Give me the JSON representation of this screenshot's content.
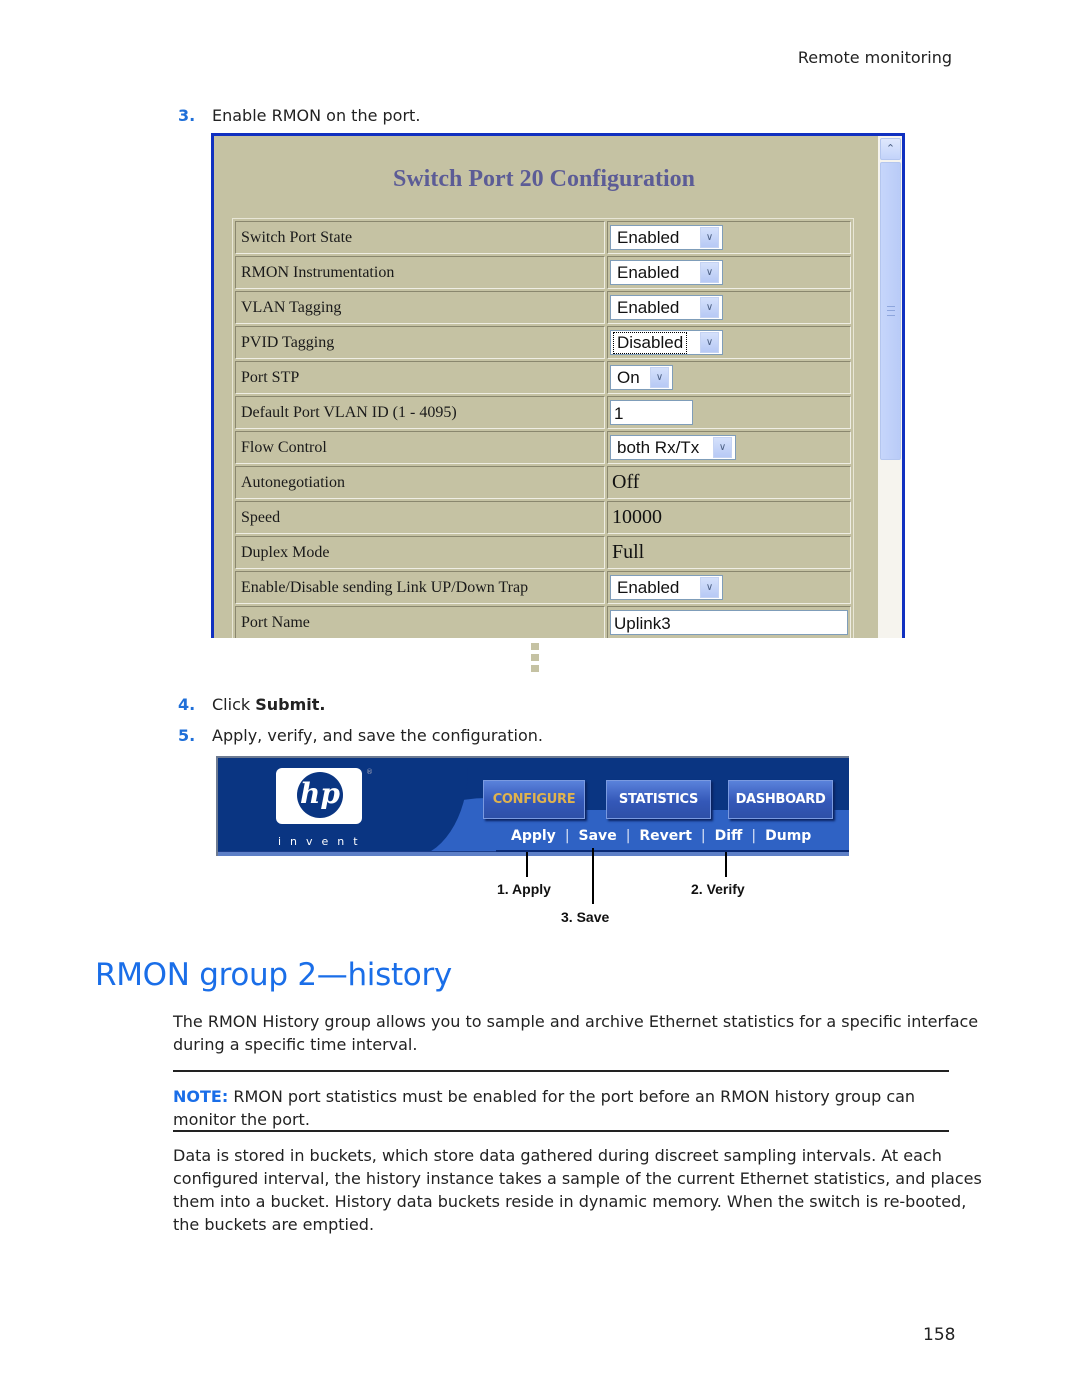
{
  "header": {
    "section": "Remote monitoring"
  },
  "steps": {
    "s3": {
      "num": "3.",
      "text": "Enable RMON on the port."
    },
    "s4": {
      "num": "4.",
      "prefix": "Click ",
      "bold": "Submit."
    },
    "s5": {
      "num": "5.",
      "text": "Apply, verify, and save the configuration."
    }
  },
  "switch_config": {
    "title": "Switch Port 20 Configuration",
    "rows": [
      {
        "label": "Switch Port State",
        "type": "select",
        "value": "Enabled"
      },
      {
        "label": "RMON Instrumentation",
        "type": "select",
        "value": "Enabled"
      },
      {
        "label": "VLAN Tagging",
        "type": "select",
        "value": "Enabled"
      },
      {
        "label": "PVID Tagging",
        "type": "select",
        "value": "Disabled"
      },
      {
        "label": "Port STP",
        "type": "select",
        "value": "On"
      },
      {
        "label": "Default Port VLAN ID (1 - 4095)",
        "type": "input",
        "value": "1"
      },
      {
        "label": "Flow Control",
        "type": "select",
        "value": "both Rx/Tx"
      },
      {
        "label": "Autonegotiation",
        "type": "text",
        "value": "Off"
      },
      {
        "label": "Speed",
        "type": "text",
        "value": "10000"
      },
      {
        "label": "Duplex Mode",
        "type": "text",
        "value": "Full"
      },
      {
        "label": "Enable/Disable sending Link UP/Down Trap",
        "type": "select",
        "value": "Enabled"
      },
      {
        "label": "Port Name",
        "type": "input",
        "value": "Uplink3"
      }
    ]
  },
  "hp_banner": {
    "logo_text": "hp",
    "tagline": "invent",
    "registered": "®",
    "tabs": [
      {
        "label": "CONFIGURE",
        "active": true
      },
      {
        "label": "STATISTICS",
        "active": false
      },
      {
        "label": "DASHBOARD",
        "active": false
      }
    ],
    "links": [
      "Apply",
      "Save",
      "Revert",
      "Diff",
      "Dump"
    ],
    "separator": "|",
    "callouts": {
      "apply": "1. Apply",
      "verify": "2. Verify",
      "save": "3. Save"
    }
  },
  "section": {
    "heading": "RMON group 2—history",
    "intro": "The RMON History group allows you to sample and archive Ethernet statistics for a specific interface during a specific time interval.",
    "note_label": "NOTE:",
    "note_text": " RMON port statistics must be enabled for the port before an RMON history group can monitor the port.",
    "body": "Data is stored in buckets, which store data gathered during discreet sampling intervals. At each configured interval, the history instance takes a sample of the current Ethernet statistics, and places them into a bucket. History data buckets reside in dynamic memory. When the switch is re-booted, the buckets are emptied."
  },
  "footer": {
    "page_number": "158"
  },
  "colors": {
    "accent_blue": "#1a6ee8",
    "config_bg": "#c5c2a3",
    "config_title": "#5c5c96",
    "hp_navy": "#0a3582",
    "configure_gold": "#e0b34e"
  }
}
